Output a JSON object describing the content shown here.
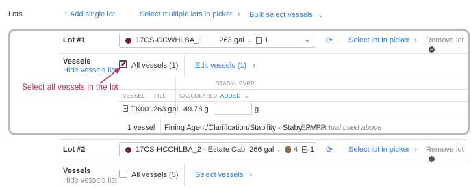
{
  "top": {
    "lots_label": "Lots",
    "add_single_lot": "+ Add single lot",
    "select_multiple_lots": "Select multiple lots in picker",
    "bulk_select_vessels": "Bulk select vessels",
    "chev_right": "›",
    "chev_down": "⌄"
  },
  "lot1": {
    "label": "Lot #1",
    "lot_code": "17CS-CCWHLBA_1",
    "volume": "263 gal",
    "vessel_count": "1",
    "select_lot_in_picker": "Select lot in picker",
    "remove_lot": "Remove lot",
    "vessels_label": "Vessels",
    "hide_vessels_list": "Hide vessels list",
    "all_vessels": "All vessels (1)",
    "edit_vessels": "Edit vessels (1)",
    "table": {
      "additive_header": "STABYL PVPP",
      "vessel_col": "VESSEL",
      "fill_col": "FILL",
      "calculated_col": "CALCULATED",
      "added_col": "ADDED",
      "rows": [
        {
          "vessel": "TK001",
          "fill": "263 gal",
          "calculated": "49.78 g",
          "added": "",
          "unit": "g"
        }
      ],
      "footer_count": "1 vessel",
      "footer_label": "Fining Agent/Clarification/Stability - Stabyl PVPP:",
      "footer_hint": "Enter actual used above"
    }
  },
  "callout_text": "Select all vessels in the lot",
  "lot2": {
    "label": "Lot #2",
    "lot_code": "17CS-HCCHLBA_2 - Estate Cab",
    "volume": "266 gal",
    "barrel_count": "4",
    "tank_count": "1",
    "select_lot_in_picker": "Select lot in picker",
    "remove_lot": "Remove lot",
    "vessels_label": "Vessels",
    "hide_vessels_list": "Hide vessels list",
    "all_vessels": "All vessels (5)",
    "select_vessels": "Select vessels"
  },
  "colors": {
    "accent": "#2a7fd4",
    "callout": "#c0286e",
    "lot_dot": "#6b1f3a",
    "highlight_border": "#b9b9b9"
  },
  "icons": [
    "plus-icon",
    "chevron-right-icon",
    "chevron-down-icon",
    "tank-icon",
    "barrel-icon",
    "refresh-icon",
    "remove-icon",
    "checkbox-icon",
    "arrow-annotation-icon"
  ]
}
